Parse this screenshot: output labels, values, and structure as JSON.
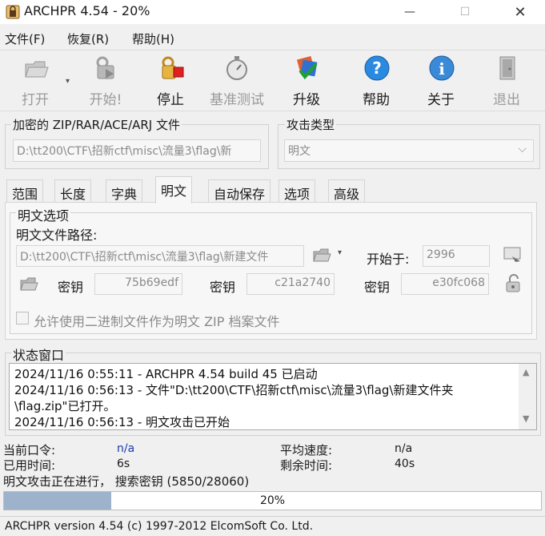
{
  "window": {
    "title": "ARCHPR 4.54 - 20%",
    "min_icon": "—",
    "max_icon": "☐",
    "close_icon": "✕"
  },
  "menu": [
    "文件(F)",
    "恢复(R)",
    "帮助(H)"
  ],
  "toolbar": [
    {
      "label": "打开",
      "enabled": false,
      "icon": "open-icon"
    },
    {
      "label": "开始!",
      "enabled": false,
      "icon": "start-icon"
    },
    {
      "label": "停止",
      "enabled": true,
      "icon": "stop-icon"
    },
    {
      "label": "基准测试",
      "enabled": false,
      "icon": "benchmark-icon"
    },
    {
      "label": "升级",
      "enabled": true,
      "icon": "upgrade-icon"
    },
    {
      "label": "帮助",
      "enabled": true,
      "icon": "help-icon"
    },
    {
      "label": "关于",
      "enabled": true,
      "icon": "about-icon"
    },
    {
      "label": "退出",
      "enabled": false,
      "icon": "exit-icon"
    }
  ],
  "encrypted": {
    "title": "加密的 ZIP/RAR/ACE/ARJ 文件",
    "path": "D:\\tt200\\CTF\\招新ctf\\misc\\流量3\\flag\\新"
  },
  "attack": {
    "title": "攻击类型",
    "value": "明文"
  },
  "tabs": [
    "范围",
    "长度",
    "字典",
    "明文",
    "自动保存",
    "选项",
    "高级"
  ],
  "plaintext": {
    "group_title": "明文选项",
    "path_label": "明文文件路径:",
    "path": "D:\\tt200\\CTF\\招新ctf\\misc\\流量3\\flag\\新建文件",
    "start_label": "开始于:",
    "start_value": "2996",
    "key_label": "密钥",
    "key1": "75b69edf",
    "key2": "c21a2740",
    "key3": "e30fc068",
    "checkbox_label": "允许使用二进制文件作为明文 ZIP 档案文件"
  },
  "status_window": {
    "title": "状态窗口",
    "lines": [
      "2024/11/16 0:55:11 - ARCHPR 4.54 build 45 已启动",
      "2024/11/16 0:56:13 - 文件\"D:\\tt200\\CTF\\招新ctf\\misc\\流量3\\flag\\新建文件夹",
      "\\flag.zip\"已打开。",
      "2024/11/16 0:56:13 - 明文攻击已开始"
    ]
  },
  "stats": {
    "current_password_label": "当前口令:",
    "current_password": "n/a",
    "elapsed_label": "已用时间:",
    "elapsed": "6s",
    "avg_speed_label": "平均速度:",
    "avg_speed": "n/a",
    "remaining_label": "剩余时间:",
    "remaining": "40s",
    "progress_text": "明文攻击正在进行，  搜索密钥 (5850/28060)"
  },
  "progress": {
    "percent": 20,
    "label": "20%",
    "fill_color": "#9db3cc"
  },
  "statusbar": "ARCHPR version 4.54 (c) 1997-2012 ElcomSoft Co. Ltd."
}
